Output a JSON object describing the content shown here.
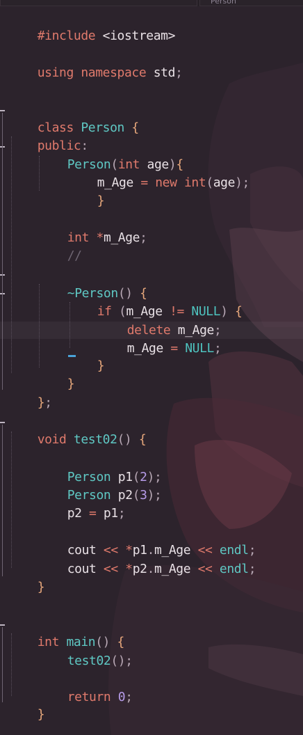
{
  "tab": {
    "label": "Person"
  },
  "colors": {
    "background": "#2c232c",
    "keyword": "#e07a6c",
    "type_name": "#5fc8c4",
    "number": "#b69be8",
    "bracket": "#e8a87c",
    "comment": "#6f6673",
    "caret": "#4aa3d9"
  },
  "code": {
    "l1_pp": "#include",
    "l1_hdr": " <iostream>",
    "l3_kw1": "using",
    "l3_kw2": " namespace",
    "l3_id": " std",
    "l3_pn": ";",
    "l6_kw": "class",
    "l6_cls": " Person",
    "l6_br": " {",
    "l7_kw": "public",
    "l7_pn": ":",
    "l8_fn": "Person",
    "l8_p1": "(",
    "l8_ty": "int",
    "l8_id": " age",
    "l8_p2": ")",
    "l8_br": "{",
    "l9_id": "m_Age",
    "l9_op": " =",
    "l9_kw": " new",
    "l9_ty": " int",
    "l9_p1": "(",
    "l9_id2": "age",
    "l9_p2": ");",
    "l10_br": "}",
    "l12_ty": "int",
    "l12_op": " *",
    "l12_id": "m_Age",
    "l12_pn": ";",
    "l13_cm": "//",
    "l15_tilde": "~",
    "l15_fn": "Person",
    "l15_p": "()",
    "l15_br": " {",
    "l16_kw": "if",
    "l16_p1": " (",
    "l16_id": "m_Age",
    "l16_op": " !=",
    "l16_mac": " NULL",
    "l16_p2": ")",
    "l16_br": " {",
    "l17_kw": "delete",
    "l17_id": " m_Age",
    "l17_pn": ";",
    "l18_id": "m_Age",
    "l18_op": " =",
    "l18_mac": " NULL",
    "l18_pn": ";",
    "l19_br": "}",
    "l20_br": "}",
    "l21_br": "}",
    "l21_pn": ";",
    "l23_ty": "void",
    "l23_fn": " test02",
    "l23_p": "()",
    "l23_br": " {",
    "l25_cls": "Person",
    "l25_id": " p1",
    "l25_p1": "(",
    "l25_num": "2",
    "l25_p2": ");",
    "l26_cls": "Person",
    "l26_id": " p2",
    "l26_p1": "(",
    "l26_num": "3",
    "l26_p2": ");",
    "l27_id": "p2",
    "l27_op": " =",
    "l27_id2": " p1",
    "l27_pn": ";",
    "l29_id": "cout",
    "l29_op": " <<",
    "l29_op2": " *",
    "l29_id2": "p1",
    "l29_pn": ".",
    "l29_id3": "m_Age",
    "l29_op3": " <<",
    "l29_fn": " endl",
    "l29_pn2": ";",
    "l30_id": "cout",
    "l30_op": " <<",
    "l30_op2": " *",
    "l30_id2": "p2",
    "l30_pn": ".",
    "l30_id3": "m_Age",
    "l30_op3": " <<",
    "l30_fn": " endl",
    "l30_pn2": ";",
    "l31_br": "}",
    "l34_ty": "int",
    "l34_fn": " main",
    "l34_p": "()",
    "l34_br": " {",
    "l35_fn": "test02",
    "l35_p": "();",
    "l37_kw": "return",
    "l37_num": " 0",
    "l37_pn": ";",
    "l38_br": "}"
  }
}
